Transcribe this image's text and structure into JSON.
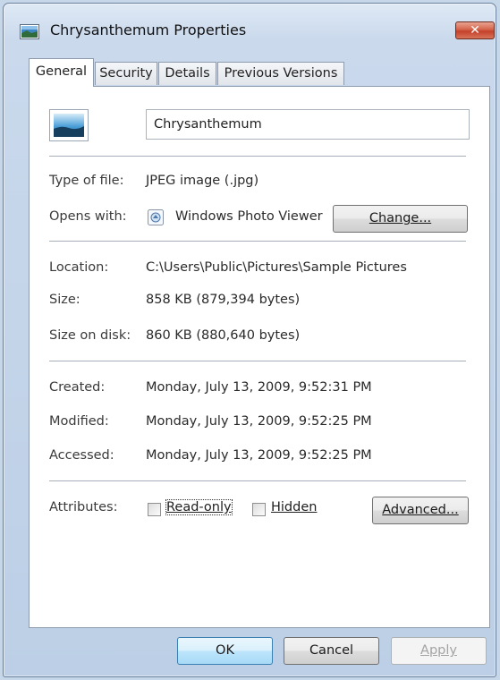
{
  "window": {
    "title": "Chrysanthemum Properties",
    "close_label": "✕"
  },
  "tabs": [
    {
      "label": "General",
      "active": true
    },
    {
      "label": "Security",
      "active": false
    },
    {
      "label": "Details",
      "active": false
    },
    {
      "label": "Previous Versions",
      "active": false
    }
  ],
  "general": {
    "file_name": "Chrysanthemum",
    "type_of_file": {
      "label": "Type of file:",
      "value": "JPEG image (.jpg)"
    },
    "opens_with": {
      "label": "Opens with:",
      "value": "Windows Photo Viewer",
      "change_button": "Change...",
      "icon": "photo-viewer-icon"
    },
    "location": {
      "label": "Location:",
      "value": "C:\\Users\\Public\\Pictures\\Sample Pictures"
    },
    "size": {
      "label": "Size:",
      "value": "858 KB (879,394 bytes)"
    },
    "size_on_disk": {
      "label": "Size on disk:",
      "value": "860 KB (880,640 bytes)"
    },
    "created": {
      "label": "Created:",
      "value": "Monday, July 13, 2009, 9:52:31 PM"
    },
    "modified": {
      "label": "Modified:",
      "value": "Monday, July 13, 2009, 9:52:25 PM"
    },
    "accessed": {
      "label": "Accessed:",
      "value": "Monday, July 13, 2009, 9:52:25 PM"
    },
    "attributes": {
      "label": "Attributes:",
      "read_only": {
        "label": "Read-only",
        "checked": false
      },
      "hidden": {
        "label": "Hidden",
        "checked": false
      },
      "advanced_button": "Advanced..."
    }
  },
  "footer": {
    "ok": "OK",
    "cancel": "Cancel",
    "apply": "Apply"
  },
  "colors": {
    "frame": "#c7d7ea",
    "close_button": "#c4402a",
    "default_button_border": "#3c7fb1"
  }
}
